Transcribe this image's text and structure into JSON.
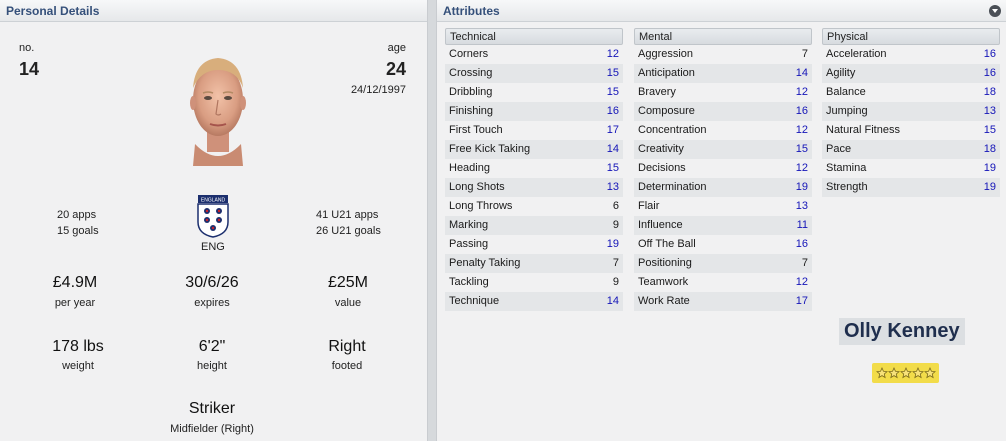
{
  "personal": {
    "title": "Personal Details",
    "number_label": "no.",
    "number": "14",
    "age_label": "age",
    "age": "24",
    "dob": "24/12/1997",
    "apps": "20 apps",
    "goals": "15 goals",
    "nation": "ENG",
    "u21_apps": "41 U21 apps",
    "u21_goals": "26 U21 goals",
    "wage": "£4.9M",
    "wage_label": "per year",
    "contract": "30/6/26",
    "contract_label": "expires",
    "value": "£25M",
    "value_label": "value",
    "weight": "178 lbs",
    "weight_label": "weight",
    "height": "6'2\"",
    "height_label": "height",
    "foot": "Right",
    "foot_label": "footed",
    "position": "Striker",
    "secondary_position": "Midfielder (Right)"
  },
  "attributes": {
    "title": "Attributes",
    "technical": {
      "header": "Technical",
      "items": [
        {
          "name": "Corners",
          "value": "12"
        },
        {
          "name": "Crossing",
          "value": "15"
        },
        {
          "name": "Dribbling",
          "value": "15"
        },
        {
          "name": "Finishing",
          "value": "16"
        },
        {
          "name": "First Touch",
          "value": "17"
        },
        {
          "name": "Free Kick Taking",
          "value": "14"
        },
        {
          "name": "Heading",
          "value": "15"
        },
        {
          "name": "Long Shots",
          "value": "13"
        },
        {
          "name": "Long Throws",
          "value": "6"
        },
        {
          "name": "Marking",
          "value": "9"
        },
        {
          "name": "Passing",
          "value": "19"
        },
        {
          "name": "Penalty Taking",
          "value": "7"
        },
        {
          "name": "Tackling",
          "value": "9"
        },
        {
          "name": "Technique",
          "value": "14"
        }
      ]
    },
    "mental": {
      "header": "Mental",
      "items": [
        {
          "name": "Aggression",
          "value": "7"
        },
        {
          "name": "Anticipation",
          "value": "14"
        },
        {
          "name": "Bravery",
          "value": "12"
        },
        {
          "name": "Composure",
          "value": "16"
        },
        {
          "name": "Concentration",
          "value": "12"
        },
        {
          "name": "Creativity",
          "value": "15"
        },
        {
          "name": "Decisions",
          "value": "12"
        },
        {
          "name": "Determination",
          "value": "19"
        },
        {
          "name": "Flair",
          "value": "13"
        },
        {
          "name": "Influence",
          "value": "11"
        },
        {
          "name": "Off The Ball",
          "value": "16"
        },
        {
          "name": "Positioning",
          "value": "7"
        },
        {
          "name": "Teamwork",
          "value": "12"
        },
        {
          "name": "Work Rate",
          "value": "17"
        }
      ]
    },
    "physical": {
      "header": "Physical",
      "items": [
        {
          "name": "Acceleration",
          "value": "16"
        },
        {
          "name": "Agility",
          "value": "16"
        },
        {
          "name": "Balance",
          "value": "18"
        },
        {
          "name": "Jumping",
          "value": "13"
        },
        {
          "name": "Natural Fitness",
          "value": "15"
        },
        {
          "name": "Pace",
          "value": "18"
        },
        {
          "name": "Stamina",
          "value": "19"
        },
        {
          "name": "Strength",
          "value": "19"
        }
      ]
    }
  },
  "player": {
    "name": "Olly Kenney",
    "star_rating": 5,
    "star_max": 5
  },
  "colors": {
    "high_value": "#1515b8",
    "normal_value": "#1a1a1a",
    "star_bg": "#f2dc4a"
  }
}
